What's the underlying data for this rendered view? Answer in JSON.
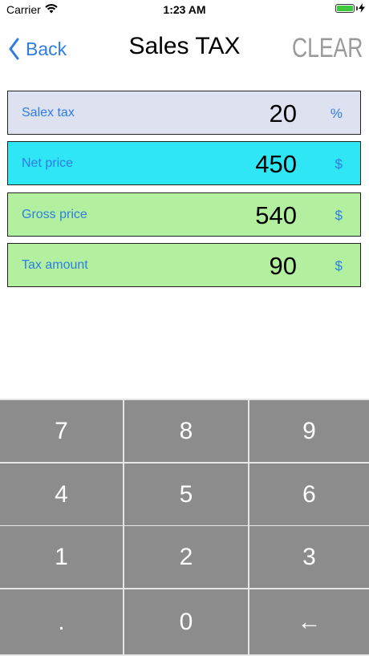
{
  "status_bar": {
    "carrier": "Carrier",
    "wifi_icon": "wifi-icon",
    "time": "1:23 AM",
    "battery_icon": "battery-icon",
    "charging_icon": "bolt-icon"
  },
  "nav": {
    "back_label": "Back",
    "back_icon": "chevron-left-icon",
    "title": "Sales TAX",
    "clear_label": "CLEAR"
  },
  "fields": [
    {
      "label": "Salex tax",
      "value": "20",
      "unit": "%",
      "color": "#dde1f0"
    },
    {
      "label": "Net price",
      "value": "450",
      "unit": "$",
      "color": "#2ee6f4"
    },
    {
      "label": "Gross price",
      "value": "540",
      "unit": "$",
      "color": "#b2f0a0"
    },
    {
      "label": "Tax amount",
      "value": "90",
      "unit": "$",
      "color": "#b2f0a0"
    }
  ],
  "keypad": {
    "rows": [
      [
        "7",
        "8",
        "9"
      ],
      [
        "4",
        "5",
        "6"
      ],
      [
        "1",
        "2",
        "3"
      ],
      [
        ".",
        "0",
        "←"
      ]
    ],
    "key_color": "#8c8c8c"
  },
  "colors": {
    "accent": "#2f7de1",
    "clear_gray": "#9a9a9a"
  }
}
